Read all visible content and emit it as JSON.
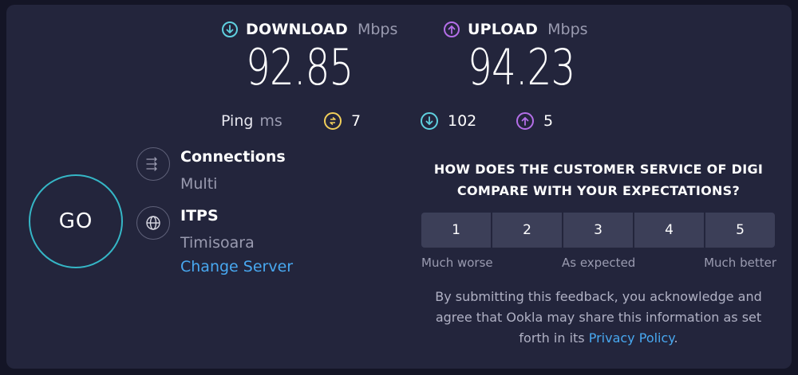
{
  "download": {
    "label": "DOWNLOAD",
    "unit": "Mbps",
    "value": "92.85",
    "icon": "download-arrow-icon",
    "color": "#5fd0df"
  },
  "upload": {
    "label": "UPLOAD",
    "unit": "Mbps",
    "value": "94.23",
    "icon": "upload-arrow-icon",
    "color": "#b46ee8"
  },
  "ping": {
    "label": "Ping",
    "unit": "ms",
    "idle": "7",
    "idle_color": "#f1cf5a",
    "down": "102",
    "up": "5"
  },
  "go_label": "GO",
  "connections": {
    "title": "Connections",
    "value": "Multi",
    "icon": "connections-icon"
  },
  "server": {
    "title": "ITPS",
    "location": "Timisoara",
    "change": "Change Server",
    "icon": "globe-icon"
  },
  "survey": {
    "question_line1": "HOW DOES THE CUSTOMER SERVICE OF DIGI",
    "question_line2": "COMPARE WITH YOUR EXPECTATIONS?",
    "options": [
      "1",
      "2",
      "3",
      "4",
      "5"
    ],
    "low": "Much worse",
    "mid": "As expected",
    "high": "Much better"
  },
  "disclaimer": {
    "line1": "By submitting this feedback, you acknowledge and",
    "line2": "agree that Ookla may share this information as set",
    "line3_prefix": "forth in its ",
    "link": "Privacy Policy",
    "suffix": "."
  }
}
